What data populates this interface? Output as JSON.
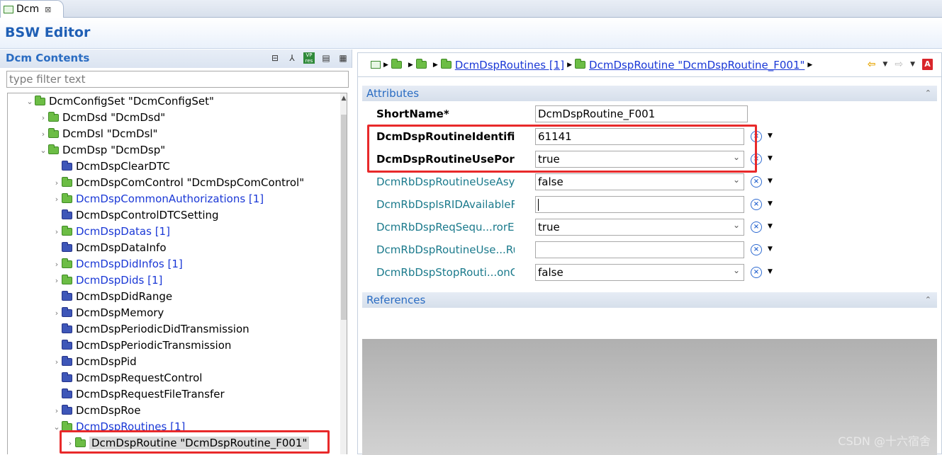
{
  "tab": {
    "label": "Dcm",
    "close": "⊠"
  },
  "editor": {
    "title": "BSW Editor"
  },
  "left": {
    "title": "Dcm Contents",
    "filter_placeholder": "type filter text",
    "tree": [
      {
        "label": "DcmConfigSet \"DcmConfigSet\"",
        "depth": 0,
        "chev": "⌄",
        "icon": "green",
        "link": false
      },
      {
        "label": "DcmDsd \"DcmDsd\"",
        "depth": 1,
        "chev": "›",
        "icon": "green",
        "link": false
      },
      {
        "label": "DcmDsl \"DcmDsl\"",
        "depth": 1,
        "chev": "›",
        "icon": "green",
        "link": false
      },
      {
        "label": "DcmDsp \"DcmDsp\"",
        "depth": 1,
        "chev": "⌄",
        "icon": "green",
        "link": false
      },
      {
        "label": "DcmDspClearDTC",
        "depth": 2,
        "chev": "",
        "icon": "blue",
        "link": false
      },
      {
        "label": "DcmDspComControl \"DcmDspComControl\"",
        "depth": 2,
        "chev": "›",
        "icon": "green",
        "link": false
      },
      {
        "label": "DcmDspCommonAuthorizations [1]",
        "depth": 2,
        "chev": "›",
        "icon": "green",
        "link": true
      },
      {
        "label": "DcmDspControlDTCSetting",
        "depth": 2,
        "chev": "",
        "icon": "blue",
        "link": false
      },
      {
        "label": "DcmDspDatas [1]",
        "depth": 2,
        "chev": "›",
        "icon": "green",
        "link": true
      },
      {
        "label": "DcmDspDataInfo",
        "depth": 2,
        "chev": "",
        "icon": "blue",
        "link": false
      },
      {
        "label": "DcmDspDidInfos [1]",
        "depth": 2,
        "chev": "›",
        "icon": "green",
        "link": true
      },
      {
        "label": "DcmDspDids [1]",
        "depth": 2,
        "chev": "›",
        "icon": "green",
        "link": true
      },
      {
        "label": "DcmDspDidRange",
        "depth": 2,
        "chev": "",
        "icon": "blue",
        "link": false
      },
      {
        "label": "DcmDspMemory",
        "depth": 2,
        "chev": "›",
        "icon": "blue",
        "link": false
      },
      {
        "label": "DcmDspPeriodicDidTransmission",
        "depth": 2,
        "chev": "",
        "icon": "blue",
        "link": false
      },
      {
        "label": "DcmDspPeriodicTransmission",
        "depth": 2,
        "chev": "",
        "icon": "blue",
        "link": false
      },
      {
        "label": "DcmDspPid",
        "depth": 2,
        "chev": "›",
        "icon": "blue",
        "link": false
      },
      {
        "label": "DcmDspRequestControl",
        "depth": 2,
        "chev": "",
        "icon": "blue",
        "link": false
      },
      {
        "label": "DcmDspRequestFileTransfer",
        "depth": 2,
        "chev": "",
        "icon": "blue",
        "link": false
      },
      {
        "label": "DcmDspRoe",
        "depth": 2,
        "chev": "›",
        "icon": "blue",
        "link": false
      },
      {
        "label": "DcmDspRoutines [1]",
        "depth": 2,
        "chev": "⌄",
        "icon": "green",
        "link": true
      },
      {
        "label": "DcmDspRoutine \"DcmDspRoutine_F001\"",
        "depth": 3,
        "chev": "›",
        "icon": "green",
        "link": false,
        "selected": true
      }
    ]
  },
  "breadcrumb": {
    "routines_link": "DcmDspRoutines [1]",
    "routine_link": "DcmDspRoutine \"DcmDspRoutine_F001\""
  },
  "attributes": {
    "section_title": "Attributes",
    "rows": [
      {
        "label": "ShortName*",
        "value": "DcmDspRoutine_F001",
        "style": "bold",
        "kind": "text"
      },
      {
        "label": "DcmDspRoutineIdentifier*",
        "value": "61141",
        "style": "bold",
        "kind": "text"
      },
      {
        "label": "DcmDspRoutineUsePort*",
        "value": "true",
        "style": "bold",
        "kind": "combo"
      },
      {
        "label": "DcmRbDspRoutineUseAsyr",
        "value": "false",
        "style": "teal",
        "kind": "combo"
      },
      {
        "label": "DcmRbDspIsRIDAvailableFr",
        "value": "",
        "style": "teal",
        "kind": "text-caret"
      },
      {
        "label": "DcmRbDspReqSequ...rorEr",
        "value": "true",
        "style": "teal",
        "kind": "combo"
      },
      {
        "label": "DcmRbDspRoutineUse...Ru",
        "value": "",
        "style": "teal",
        "kind": "text"
      },
      {
        "label": "DcmRbDspStopRouti...onC",
        "value": "false",
        "style": "teal",
        "kind": "combo"
      }
    ]
  },
  "references": {
    "section_title": "References"
  },
  "watermark": "CSDN @十六宿舍",
  "colors": {
    "accent": "#2a6cc2",
    "highlight": "#e8292a",
    "link": "#1a38d6",
    "teal": "#1b7a8c"
  }
}
